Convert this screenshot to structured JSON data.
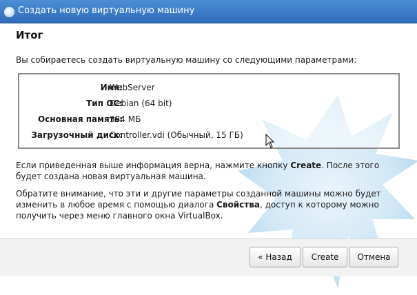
{
  "window": {
    "title": "Создать новую виртуальную машину",
    "icon": "virtualbox-icon",
    "accent_color": "#3a7cc7"
  },
  "header": {
    "title": "Итог"
  },
  "main": {
    "intro": "Вы собираетесь создать виртуальную машину со следующими параметрами:",
    "params": [
      {
        "label": "Имя:",
        "value": "WebServer"
      },
      {
        "label": "Тип ОС:",
        "value": "Debian (64 bit)"
      },
      {
        "label": "Основная память:",
        "value": "384 МБ"
      },
      {
        "label": "Загрузочный диск:",
        "value": "Controller.vdi (Обычный, 15 ГБ)"
      }
    ],
    "para1_a": "Если приведенная выше информация верна, нажмите кнопку ",
    "para1_b": "Create",
    "para1_c": ". После этого будет создана новая виртуальная машина.",
    "para2_a": "Обратите внимание, что эти и другие параметры созданной машины можно будет изменить в любое время с помощью диалога ",
    "para2_b": "Свойства",
    "para2_c": ", доступ к которому можно получить через меню главного окна VirtualBox."
  },
  "footer": {
    "back_label": "« Назад",
    "create_label": "Create",
    "cancel_label": "Отмена"
  }
}
